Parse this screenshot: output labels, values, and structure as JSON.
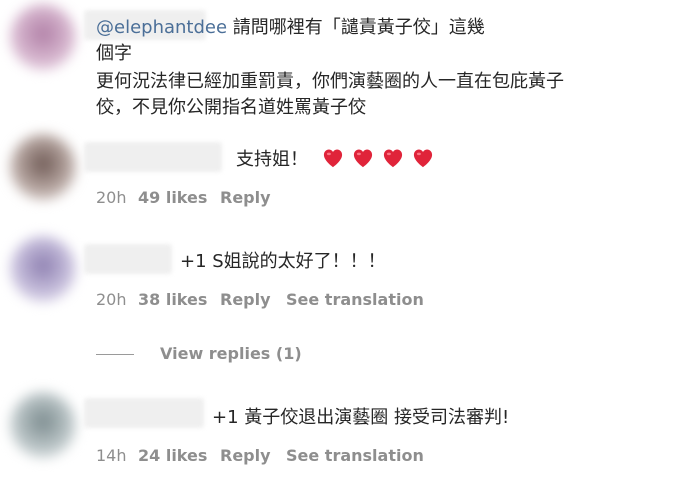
{
  "comments": [
    {
      "mention": "@elephantdee",
      "text_line1": " 請問哪裡有「譴責黃子佼」這幾",
      "text_line2": "個字",
      "text_line3": "更何況法律已經加重罰責，你們演藝圈的人一直在包庇黃子",
      "text_line4": "佼，不見你公開指名道姓罵黃子佼"
    },
    {
      "text": "支持姐！",
      "emoji_count": 4,
      "emoji_icon": "red-heart-icon",
      "time": "20h",
      "likes": "49 likes",
      "reply": "Reply"
    },
    {
      "text": "+1 S姐說的太好了！！！",
      "time": "20h",
      "likes": "38 likes",
      "reply": "Reply",
      "translate": "See translation"
    },
    {
      "text": "+1 黃子佼退出演藝圈 接受司法審判!",
      "time": "14h",
      "likes": "24 likes",
      "reply": "Reply",
      "translate": "See translation"
    }
  ],
  "view_replies": "View replies (1)",
  "colors": {
    "text": "#262626",
    "meta": "#8e8e8e",
    "mention": "#4b6f98",
    "heart": "#e0243a"
  }
}
